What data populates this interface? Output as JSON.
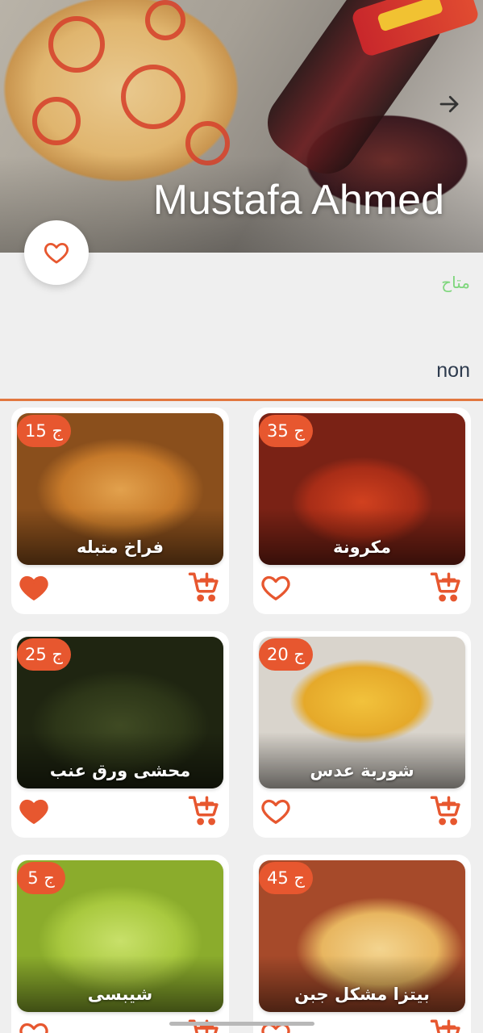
{
  "header": {
    "title": "Mustafa Ahmed",
    "back_icon": "arrow-right-icon",
    "favorite_icon": "heart-outline-icon"
  },
  "restaurant": {
    "status": "متاح",
    "description": "non"
  },
  "colors": {
    "accent": "#e7572f",
    "status_green": "#7ed67c",
    "divider": "#e2773f",
    "text_dark": "#2e3b4e"
  },
  "products": [
    {
      "name": "مكرونة",
      "price": "35 ج",
      "favorited": false
    },
    {
      "name": "فراخ متبله",
      "price": "15 ج",
      "favorited": true
    },
    {
      "name": "شوربة عدس",
      "price": "20 ج",
      "favorited": false
    },
    {
      "name": "محشى ورق عنب",
      "price": "25 ج",
      "favorited": true
    },
    {
      "name": "بيتزا مشكل جبن",
      "price": "45 ج",
      "favorited": false
    },
    {
      "name": "شيبسى",
      "price": "5 ج",
      "favorited": false
    }
  ]
}
